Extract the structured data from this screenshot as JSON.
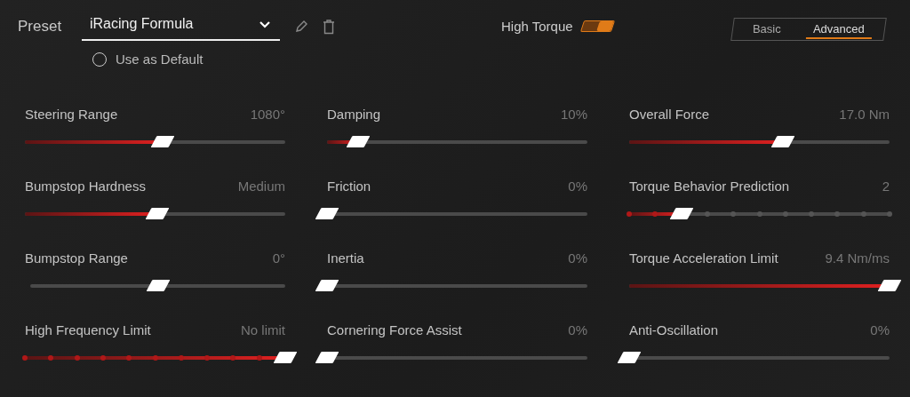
{
  "preset": {
    "label": "Preset",
    "value": "iRacing Formula",
    "use_as_default": {
      "label": "Use as Default",
      "checked": false
    }
  },
  "high_torque": {
    "label": "High Torque",
    "on": true
  },
  "tabs": [
    {
      "label": "Basic",
      "selected": false
    },
    {
      "label": "Advanced",
      "selected": true
    }
  ],
  "columns": [
    [
      {
        "name": "Steering Range",
        "reading": "1080°",
        "kind": "plain",
        "level": 0.53
      },
      {
        "name": "Bumpstop Hardness",
        "reading": "Medium",
        "kind": "plain",
        "level": 0.51
      },
      {
        "name": "Bumpstop Range",
        "reading": "0°",
        "kind": "centered",
        "level": 0.5
      },
      {
        "name": "High Frequency Limit",
        "reading": "No limit",
        "kind": "stepped",
        "level": 1.0
      }
    ],
    [
      {
        "name": "Damping",
        "reading": "10%",
        "kind": "plain",
        "level": 0.12
      },
      {
        "name": "Friction",
        "reading": "0%",
        "kind": "plain",
        "level": 0
      },
      {
        "name": "Inertia",
        "reading": "0%",
        "kind": "plain",
        "level": 0
      },
      {
        "name": "Cornering Force Assist",
        "reading": "0%",
        "kind": "plain",
        "level": 0
      }
    ],
    [
      {
        "name": "Overall Force",
        "reading": "17.0 Nm",
        "kind": "plain",
        "level": 0.59
      },
      {
        "name": "Torque Behavior Prediction",
        "reading": "2",
        "kind": "stepped",
        "level": 0.2
      },
      {
        "name": "Torque Acceleration Limit",
        "reading": "9.4 Nm/ms",
        "kind": "plain",
        "level": 1.0
      },
      {
        "name": "Anti-Oscillation",
        "reading": "0%",
        "kind": "plain",
        "level": 0
      }
    ]
  ]
}
